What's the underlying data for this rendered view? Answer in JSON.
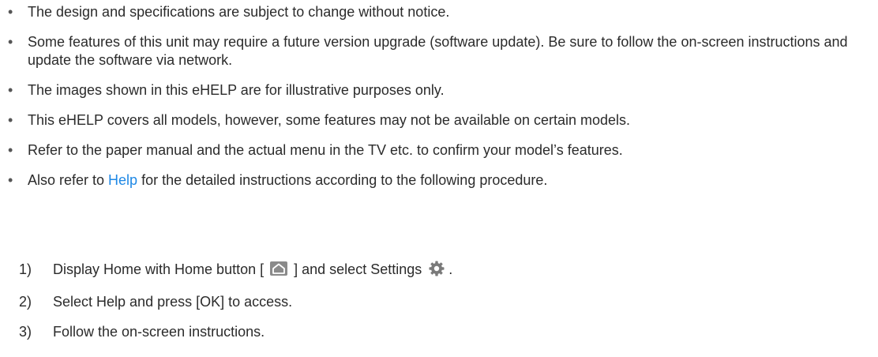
{
  "notes": [
    {
      "text": "The design and specifications are subject to change without notice."
    },
    {
      "text": "Some features of this unit may require a future version upgrade (software update). Be sure to follow the on-screen instructions and update the software via network."
    },
    {
      "text": "The images shown in this eHELP are for illustrative purposes only."
    },
    {
      "text": "This eHELP covers all models, however, some features may not be available on certain models."
    },
    {
      "text": "Refer to the paper manual and the actual menu in the TV etc. to confirm your model’s features."
    },
    {
      "before": "Also refer to ",
      "link": "Help",
      "after": " for the detailed instructions according to the following procedure."
    }
  ],
  "bullet": "•",
  "steps": [
    {
      "num": "1)",
      "before": "Display Home with Home button [",
      "after": "] and select Settings",
      "end": "."
    },
    {
      "num": "2)",
      "text": "Select Help and press [OK] to access."
    },
    {
      "num": "3)",
      "text": "Follow the on-screen instructions."
    }
  ],
  "colors": {
    "link": "#1e88e5",
    "text": "#2b2b2b",
    "icon": "#8a8a8a"
  },
  "icons": {
    "home": "home-icon",
    "settings": "gear-icon"
  }
}
